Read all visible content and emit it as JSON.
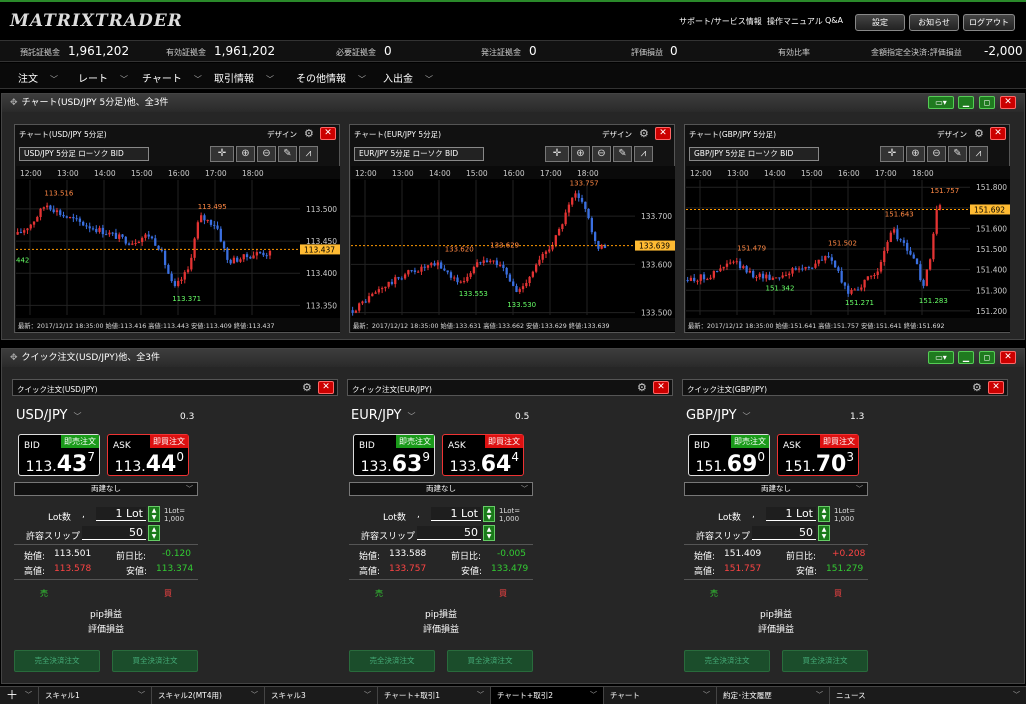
{
  "header": {
    "logo": "MATRIXTRADER",
    "links": [
      "サポート/サービス情報",
      "操作マニュアル",
      "Q&A"
    ],
    "buttons": [
      "設定",
      "お知らせ",
      "ログアウト"
    ]
  },
  "account": [
    {
      "label": "預託証拠金",
      "value": "1,961,202"
    },
    {
      "label": "有効証拠金",
      "value": "1,961,202"
    },
    {
      "label": "必要証拠金",
      "value": "0"
    },
    {
      "label": "発注証拠金",
      "value": "0"
    },
    {
      "label": "評価損益",
      "value": "0"
    },
    {
      "label": "有効比率",
      "value": ""
    },
    {
      "label": "金額指定全決済:評価損益",
      "value": "-2,000"
    }
  ],
  "menu": [
    "注文",
    "レート",
    "チャート",
    "取引情報",
    "その他情報",
    "入出金"
  ],
  "chart_section": {
    "title": "チャート(USD/JPY 5分足)他、全3件"
  },
  "quick_section": {
    "title": "クイック注文(USD/JPY)他、全3件"
  },
  "ui": {
    "design": "デザイン",
    "both_label": "両建なし"
  },
  "chart_data": [
    {
      "type": "candlestick",
      "title": "チャート(USD/JPY 5分足)",
      "select": "USD/JPY  5分足 ローソク BID",
      "x_ticks": [
        "12:00",
        "13:00",
        "14:00",
        "15:00",
        "16:00",
        "17:00",
        "18:00"
      ],
      "y_ticks": [
        "113.500",
        "113.450",
        "113.400",
        "113.350"
      ],
      "ylim": [
        113.335,
        113.545
      ],
      "current": "113.437",
      "current_value": 113.437,
      "annotations": [
        {
          "text": "113.516",
          "x": 0.1,
          "y": 113.516,
          "color": "#f84"
        },
        {
          "text": "113.495",
          "x": 0.64,
          "y": 113.495,
          "color": "#f84"
        },
        {
          "text": "113.371",
          "x": 0.55,
          "y": 113.371,
          "color": "#6f6"
        },
        {
          "text": "442",
          "x": 0.0,
          "y": 113.431,
          "color": "#6f6"
        }
      ],
      "waypoints": [
        [
          0,
          113.46
        ],
        [
          0.05,
          113.478
        ],
        [
          0.1,
          113.508
        ],
        [
          0.16,
          113.49
        ],
        [
          0.24,
          113.475
        ],
        [
          0.32,
          113.462
        ],
        [
          0.4,
          113.448
        ],
        [
          0.46,
          113.46
        ],
        [
          0.5,
          113.44
        ],
        [
          0.55,
          113.374
        ],
        [
          0.6,
          113.405
        ],
        [
          0.64,
          113.488
        ],
        [
          0.7,
          113.475
        ],
        [
          0.74,
          113.418
        ],
        [
          0.8,
          113.425
        ],
        [
          0.85,
          113.432
        ],
        [
          0.9,
          113.43
        ]
      ],
      "footer": "最新：2017/12/12 18:35:00  始値:113.416  高値:113.443  安値:113.409  終値:113.437"
    },
    {
      "type": "candlestick",
      "title": "チャート(EUR/JPY 5分足)",
      "select": "EUR/JPY  5分足 ローソク BID",
      "x_ticks": [
        "12:00",
        "13:00",
        "14:00",
        "15:00",
        "16:00",
        "17:00",
        "18:00"
      ],
      "y_ticks": [
        "133.700",
        "133.600",
        "133.500"
      ],
      "ylim": [
        133.495,
        133.775
      ],
      "current": "133.639",
      "current_value": 133.639,
      "annotations": [
        {
          "text": "133.757",
          "x": 0.77,
          "y": 133.757,
          "color": "#f84"
        },
        {
          "text": "133.620",
          "x": 0.33,
          "y": 133.62,
          "color": "#f84"
        },
        {
          "text": "133.629",
          "x": 0.49,
          "y": 133.629,
          "color": "#f84"
        },
        {
          "text": "133.553",
          "x": 0.38,
          "y": 133.553,
          "color": "#6f6"
        },
        {
          "text": "133.530",
          "x": 0.55,
          "y": 133.53,
          "color": "#6f6"
        }
      ],
      "waypoints": [
        [
          0,
          133.505
        ],
        [
          0.1,
          133.55
        ],
        [
          0.2,
          133.585
        ],
        [
          0.3,
          133.6
        ],
        [
          0.38,
          133.56
        ],
        [
          0.46,
          133.615
        ],
        [
          0.52,
          133.6
        ],
        [
          0.58,
          133.54
        ],
        [
          0.65,
          133.6
        ],
        [
          0.72,
          133.66
        ],
        [
          0.78,
          133.745
        ],
        [
          0.82,
          133.72
        ],
        [
          0.86,
          133.63
        ],
        [
          0.9,
          133.64
        ]
      ],
      "footer": "最新：2017/12/12 18:35:00  始値:133.631  高値:133.662  安値:133.629  終値:133.639"
    },
    {
      "type": "candlestick",
      "title": "チャート(GBP/JPY 5分足)",
      "select": "GBP/JPY  5分足 ローソク BID",
      "x_ticks": [
        "12:00",
        "13:00",
        "14:00",
        "15:00",
        "16:00",
        "17:00",
        "18:00"
      ],
      "y_ticks": [
        "151.800",
        "151.700",
        "151.600",
        "151.500",
        "151.400",
        "151.300",
        "151.200"
      ],
      "ylim": [
        151.18,
        151.835
      ],
      "current": "151.692",
      "current_value": 151.692,
      "annotations": [
        {
          "text": "151.757",
          "x": 0.86,
          "y": 151.757,
          "color": "#f84"
        },
        {
          "text": "151.643",
          "x": 0.7,
          "y": 151.643,
          "color": "#f84"
        },
        {
          "text": "151.479",
          "x": 0.18,
          "y": 151.479,
          "color": "#f84"
        },
        {
          "text": "151.502",
          "x": 0.5,
          "y": 151.502,
          "color": "#f84"
        },
        {
          "text": "151.342",
          "x": 0.28,
          "y": 151.342,
          "color": "#6f6"
        },
        {
          "text": "151.271",
          "x": 0.56,
          "y": 151.271,
          "color": "#6f6"
        },
        {
          "text": "151.283",
          "x": 0.82,
          "y": 151.283,
          "color": "#6f6"
        }
      ],
      "waypoints": [
        [
          0,
          151.35
        ],
        [
          0.08,
          151.37
        ],
        [
          0.16,
          151.44
        ],
        [
          0.22,
          151.38
        ],
        [
          0.3,
          151.36
        ],
        [
          0.38,
          151.4
        ],
        [
          0.44,
          151.42
        ],
        [
          0.5,
          151.47
        ],
        [
          0.56,
          151.29
        ],
        [
          0.62,
          151.33
        ],
        [
          0.68,
          151.42
        ],
        [
          0.72,
          151.6
        ],
        [
          0.76,
          151.52
        ],
        [
          0.8,
          151.45
        ],
        [
          0.83,
          151.31
        ],
        [
          0.86,
          151.5
        ],
        [
          0.88,
          151.72
        ],
        [
          0.9,
          151.69
        ]
      ],
      "footer": "最新：2017/12/12 18:35:00  始値:151.641  高値:151.757  安値:151.641  終値:151.692"
    }
  ],
  "quick_orders": [
    {
      "title": "クイック注文(USD/JPY)",
      "symbol": "USD/JPY",
      "spread": "0.3",
      "bid": {
        "label": "BID",
        "tag": "即売注文",
        "small": "113.",
        "large": "43",
        "sup": "7"
      },
      "ask": {
        "label": "ASK",
        "tag": "即買注文",
        "small": "113.",
        "large": "44",
        "sup": "0"
      },
      "lot_label": "Lot数",
      "lot_value": "1 Lot",
      "lot_unit_a": "1Lot=",
      "lot_unit_b": "1,000",
      "slip_label": "許容スリップ",
      "slip_value": "50",
      "open_label": "始値:",
      "open": "113.501",
      "change_label": "前日比:",
      "change": "-0.120",
      "high_label": "高値:",
      "high": "113.578",
      "low_label": "安値:",
      "low": "113.374",
      "sell": "売",
      "buy": "買",
      "pip": "pip損益",
      "eval": "評価損益",
      "btn_sell": "売全決済注文",
      "btn_buy": "買全決済注文"
    },
    {
      "title": "クイック注文(EUR/JPY)",
      "symbol": "EUR/JPY",
      "spread": "0.5",
      "bid": {
        "label": "BID",
        "tag": "即売注文",
        "small": "133.",
        "large": "63",
        "sup": "9"
      },
      "ask": {
        "label": "ASK",
        "tag": "即買注文",
        "small": "133.",
        "large": "64",
        "sup": "4"
      },
      "lot_label": "Lot数",
      "lot_value": "1 Lot",
      "lot_unit_a": "1Lot=",
      "lot_unit_b": "1,000",
      "slip_label": "許容スリップ",
      "slip_value": "50",
      "open_label": "始値:",
      "open": "133.588",
      "change_label": "前日比:",
      "change": "-0.005",
      "high_label": "高値:",
      "high": "133.757",
      "low_label": "安値:",
      "low": "133.479",
      "sell": "売",
      "buy": "買",
      "pip": "pip損益",
      "eval": "評価損益",
      "btn_sell": "売全決済注文",
      "btn_buy": "買全決済注文"
    },
    {
      "title": "クイック注文(GBP/JPY)",
      "symbol": "GBP/JPY",
      "spread": "1.3",
      "bid": {
        "label": "BID",
        "tag": "即売注文",
        "small": "151.",
        "large": "69",
        "sup": "0"
      },
      "ask": {
        "label": "ASK",
        "tag": "即買注文",
        "small": "151.",
        "large": "70",
        "sup": "3"
      },
      "lot_label": "Lot数",
      "lot_value": "1 Lot",
      "lot_unit_a": "1Lot=",
      "lot_unit_b": "1,000",
      "slip_label": "許容スリップ",
      "slip_value": "50",
      "open_label": "始値:",
      "open": "151.409",
      "change_label": "前日比:",
      "change": "+0.208",
      "high_label": "高値:",
      "high": "151.757",
      "low_label": "安値:",
      "low": "151.279",
      "sell": "売",
      "buy": "買",
      "pip": "pip損益",
      "eval": "評価損益",
      "btn_sell": "売全決済注文",
      "btn_buy": "買全決済注文"
    }
  ],
  "footer_tabs": [
    "スキャル1",
    "スキャル2(MT4用)",
    "スキャル3",
    "チャート+取引1",
    "チャート+取引2",
    "チャート",
    "約定･注文履歴",
    "ニュース"
  ],
  "active_tab": 4,
  "colors": {
    "accent": "#1a9a1a",
    "danger": "#dd1111",
    "bull": "#e33333",
    "bear": "#3a6fe0"
  }
}
